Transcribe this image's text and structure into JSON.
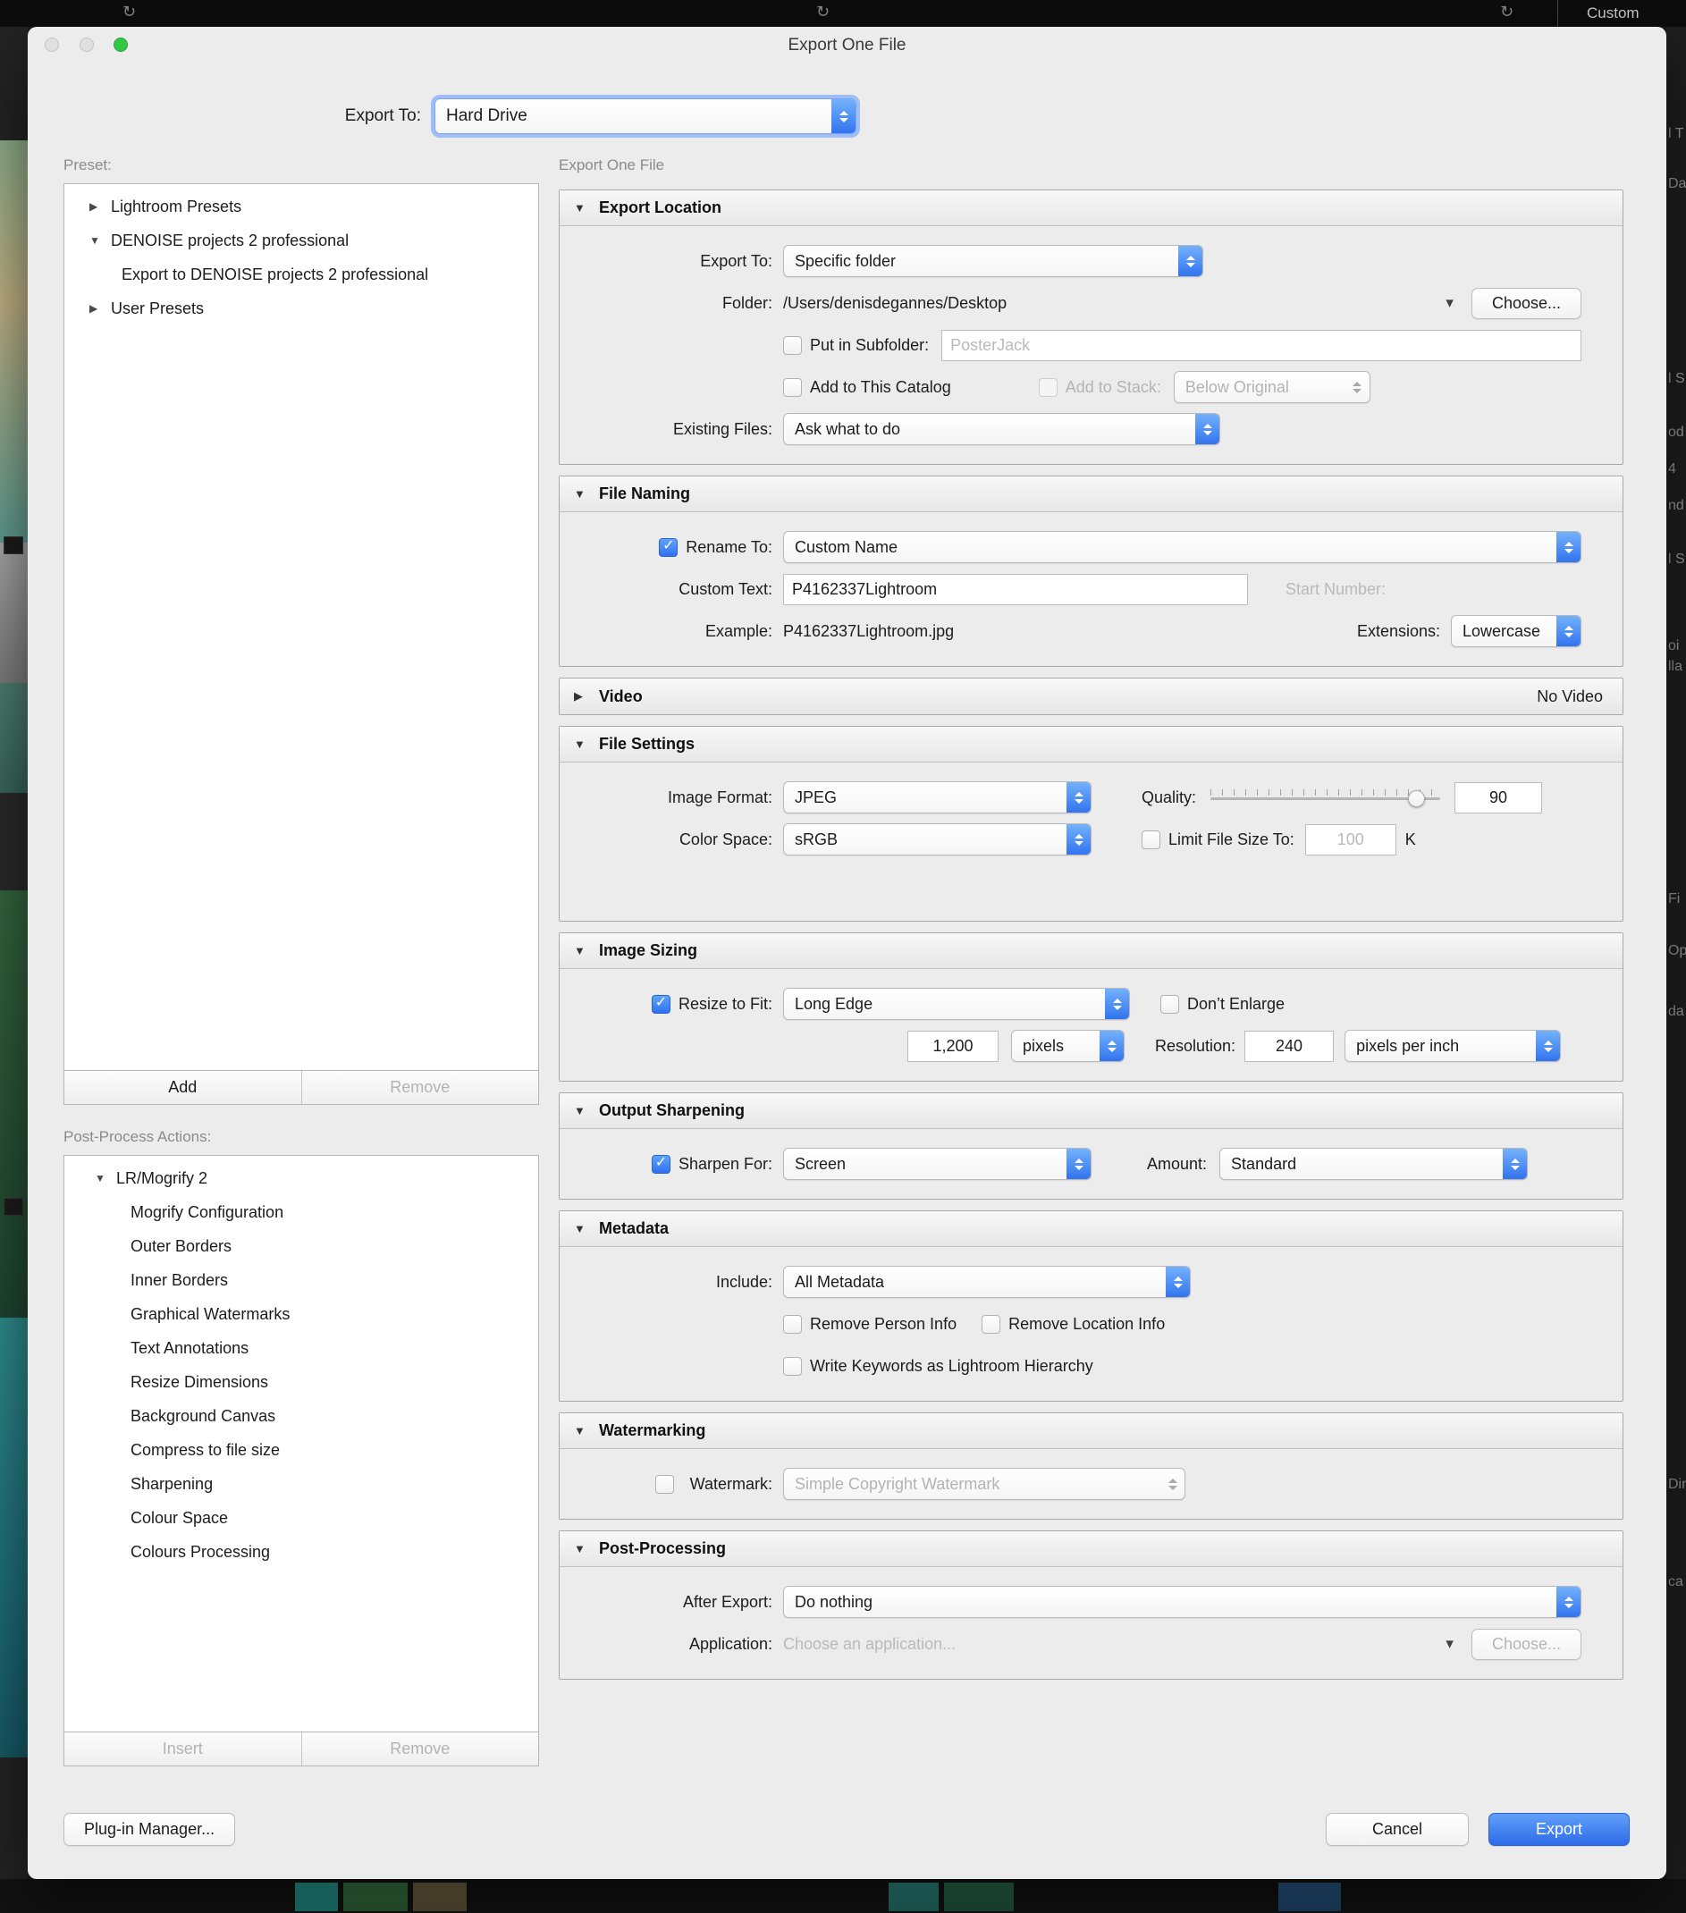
{
  "window": {
    "title": "Export One File"
  },
  "toolbar": {
    "export_to_label": "Export To:",
    "export_to_value": "Hard Drive"
  },
  "icons": {
    "disclosure_expanded": "▼",
    "disclosure_collapsed": "▶",
    "checkmark": "✓",
    "dropdown_caret": "▾",
    "rotate": "↻"
  },
  "preset_panel": {
    "label": "Preset:",
    "items": [
      {
        "label": "Lightroom Presets"
      },
      {
        "label": "DENOISE projects 2 professional"
      },
      {
        "label": "Export to DENOISE projects 2 professional"
      },
      {
        "label": "User Presets"
      }
    ],
    "add_label": "Add",
    "remove_label": "Remove"
  },
  "post_process_panel": {
    "label": "Post-Process Actions:",
    "items": [
      {
        "label": "LR/Mogrify 2"
      },
      {
        "label": "Mogrify Configuration"
      },
      {
        "label": "Outer Borders"
      },
      {
        "label": "Inner Borders"
      },
      {
        "label": "Graphical Watermarks"
      },
      {
        "label": "Text Annotations"
      },
      {
        "label": "Resize Dimensions"
      },
      {
        "label": "Background Canvas"
      },
      {
        "label": "Compress to file size"
      },
      {
        "label": "Sharpening"
      },
      {
        "label": "Colour Space"
      },
      {
        "label": "Colours Processing"
      }
    ],
    "insert_label": "Insert",
    "remove_label": "Remove"
  },
  "main": {
    "header": "Export One File",
    "export_location": {
      "title": "Export Location",
      "export_to_label": "Export To:",
      "export_to_value": "Specific folder",
      "folder_label": "Folder:",
      "folder_value": "/Users/denisdegannes/Desktop",
      "choose_label": "Choose...",
      "subfolder_label": "Put in Subfolder:",
      "subfolder_value": "PosterJack",
      "add_to_catalog_label": "Add to This Catalog",
      "add_to_stack_label": "Add to Stack:",
      "stack_value": "Below Original",
      "existing_files_label": "Existing Files:",
      "existing_files_value": "Ask what to do"
    },
    "file_naming": {
      "title": "File Naming",
      "rename_label": "Rename To:",
      "rename_value": "Custom Name",
      "custom_text_label": "Custom Text:",
      "custom_text_value": "P4162337Lightroom",
      "start_number_label": "Start Number:",
      "example_label": "Example:",
      "example_value": "P4162337Lightroom.jpg",
      "extensions_label": "Extensions:",
      "extensions_value": "Lowercase"
    },
    "video": {
      "title": "Video",
      "status": "No Video"
    },
    "file_settings": {
      "title": "File Settings",
      "image_format_label": "Image Format:",
      "image_format_value": "JPEG",
      "quality_label": "Quality:",
      "quality_value": "90",
      "color_space_label": "Color Space:",
      "color_space_value": "sRGB",
      "limit_label": "Limit File Size To:",
      "limit_value": "100",
      "limit_unit": "K"
    },
    "image_sizing": {
      "title": "Image Sizing",
      "resize_label": "Resize to Fit:",
      "resize_value": "Long Edge",
      "dont_enlarge_label": "Don’t Enlarge",
      "size_value": "1,200",
      "size_unit": "pixels",
      "resolution_label": "Resolution:",
      "resolution_value": "240",
      "resolution_unit": "pixels per inch"
    },
    "output_sharpening": {
      "title": "Output Sharpening",
      "sharpen_label": "Sharpen For:",
      "sharpen_value": "Screen",
      "amount_label": "Amount:",
      "amount_value": "Standard"
    },
    "metadata": {
      "title": "Metadata",
      "include_label": "Include:",
      "include_value": "All Metadata",
      "remove_person_label": "Remove Person Info",
      "remove_location_label": "Remove Location Info",
      "keywords_label": "Write Keywords as Lightroom Hierarchy"
    },
    "watermarking": {
      "title": "Watermarking",
      "watermark_label": "Watermark:",
      "watermark_value": "Simple Copyright Watermark"
    },
    "post_processing": {
      "title": "Post-Processing",
      "after_export_label": "After Export:",
      "after_export_value": "Do nothing",
      "application_label": "Application:",
      "application_value": "Choose an application...",
      "choose_label": "Choose..."
    }
  },
  "footer": {
    "plugin_manager_label": "Plug-in Manager...",
    "cancel_label": "Cancel",
    "export_label": "Export"
  },
  "background": {
    "custom_label": "Custom",
    "right_fragments": [
      "l T",
      "Da",
      "l S",
      "od",
      "4",
      "nd",
      "l S",
      "oi",
      "lla",
      "Fi",
      "Op",
      "da",
      "Dim",
      "ca"
    ]
  }
}
